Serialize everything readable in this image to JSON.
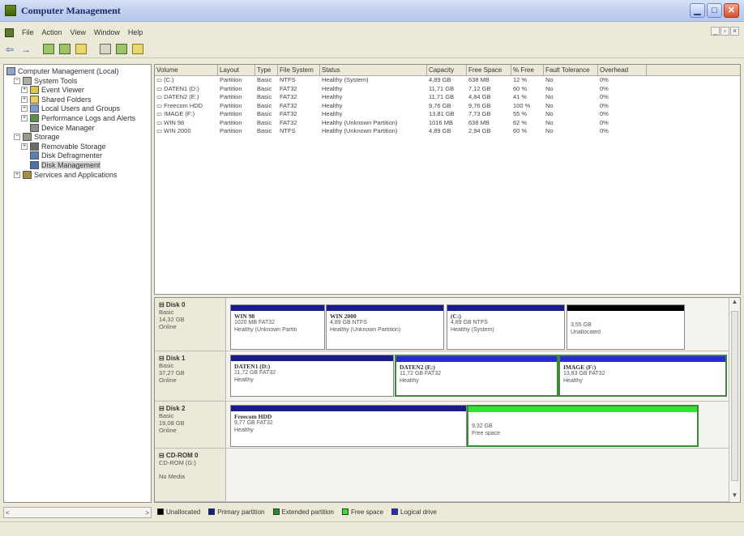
{
  "window": {
    "title": "Computer Management"
  },
  "menu": {
    "items": [
      "File",
      "Action",
      "View",
      "Window",
      "Help"
    ]
  },
  "tree": {
    "nodes": [
      {
        "label": "Computer Management (Local)",
        "indent": 0,
        "icon": "computer-icon",
        "expander": ""
      },
      {
        "label": "System Tools",
        "indent": 1,
        "icon": "tools-icon",
        "expander": "−"
      },
      {
        "label": "Event Viewer",
        "indent": 2,
        "icon": "event-viewer-icon",
        "expander": "+"
      },
      {
        "label": "Shared Folders",
        "indent": 2,
        "icon": "shared-folder-icon",
        "expander": "+"
      },
      {
        "label": "Local Users and Groups",
        "indent": 2,
        "icon": "users-icon",
        "expander": "+"
      },
      {
        "label": "Performance Logs and Alerts",
        "indent": 2,
        "icon": "performance-icon",
        "expander": "+"
      },
      {
        "label": "Device Manager",
        "indent": 2,
        "icon": "device-manager-icon",
        "expander": ""
      },
      {
        "label": "Storage",
        "indent": 1,
        "icon": "storage-icon",
        "expander": "−"
      },
      {
        "label": "Removable Storage",
        "indent": 2,
        "icon": "removable-storage-icon",
        "expander": "+"
      },
      {
        "label": "Disk Defragmenter",
        "indent": 2,
        "icon": "defragmenter-icon",
        "expander": ""
      },
      {
        "label": "Disk Management",
        "indent": 2,
        "icon": "disk-management-icon",
        "expander": "",
        "selected": true
      },
      {
        "label": "Services and Applications",
        "indent": 1,
        "icon": "services-icon",
        "expander": "+"
      }
    ]
  },
  "volumes": {
    "columns": [
      "Volume",
      "Layout",
      "Type",
      "File System",
      "Status",
      "Capacity",
      "Free Space",
      "% Free",
      "Fault Tolerance",
      "Overhead"
    ],
    "rows": [
      [
        "(C:)",
        "Partition",
        "Basic",
        "NTFS",
        "Healthy (System)",
        "4,89 GB",
        "638 MB",
        "12 %",
        "No",
        "0%"
      ],
      [
        "DATEN1 (D:)",
        "Partition",
        "Basic",
        "FAT32",
        "Healthy",
        "11,71 GB",
        "7,12 GB",
        "60 %",
        "No",
        "0%"
      ],
      [
        "DATEN2 (E:)",
        "Partition",
        "Basic",
        "FAT32",
        "Healthy",
        "11,71 GB",
        "4,84 GB",
        "41 %",
        "No",
        "0%"
      ],
      [
        "Freecom HDD",
        "Partition",
        "Basic",
        "FAT32",
        "Healthy",
        "9,76 GB",
        "9,76 GB",
        "100 %",
        "No",
        "0%"
      ],
      [
        "IMAGE (F:)",
        "Partition",
        "Basic",
        "FAT32",
        "Healthy",
        "13,81 GB",
        "7,73 GB",
        "55 %",
        "No",
        "0%"
      ],
      [
        "WIN 98",
        "Partition",
        "Basic",
        "FAT32",
        "Healthy (Unknown Partition)",
        "1016 MB",
        "638 MB",
        "62 %",
        "No",
        "0%"
      ],
      [
        "WIN 2000",
        "Partition",
        "Basic",
        "NTFS",
        "Healthy (Unknown Partition)",
        "4,89 GB",
        "2,94 GB",
        "60 %",
        "No",
        "0%"
      ]
    ]
  },
  "disks": [
    {
      "name": "Disk 0",
      "type": "Basic",
      "size": "14,32 GB",
      "status": "Online",
      "partitions": [
        {
          "name": "WIN 98",
          "line1": "1020 MB FAT32",
          "line2": "Healthy (Unknown Partiti",
          "kind": "primary"
        },
        {
          "name": "WIN 2000",
          "line1": "4,89 GB NTFS",
          "line2": "Healthy (Unknown Partition)",
          "kind": "primary"
        },
        {
          "name": "(C:)",
          "line1": "4,89 GB NTFS",
          "line2": "Healthy (System)",
          "kind": "primary"
        },
        {
          "name": "",
          "line1": "3,55 GB",
          "line2": "Unallocated",
          "kind": "unallocated"
        }
      ]
    },
    {
      "name": "Disk 1",
      "type": "Basic",
      "size": "37,27 GB",
      "status": "Online",
      "partitions": [
        {
          "name": "DATEN1 (D:)",
          "line1": "11,72 GB FAT32",
          "line2": "Healthy",
          "kind": "primary"
        },
        {
          "name": "DATEN2 (E:)",
          "line1": "11,72 GB FAT32",
          "line2": "Healthy",
          "kind": "logical"
        },
        {
          "name": "IMAGE (F:)",
          "line1": "13,83 GB FAT32",
          "line2": "Healthy",
          "kind": "logical"
        }
      ]
    },
    {
      "name": "Disk 2",
      "type": "Basic",
      "size": "19,08 GB",
      "status": "Online",
      "partitions": [
        {
          "name": "Freecom HDD",
          "line1": "9,77 GB FAT32",
          "line2": "Healthy",
          "kind": "primary"
        },
        {
          "name": "",
          "line1": "9,32 GB",
          "line2": "Free space",
          "kind": "free"
        }
      ]
    },
    {
      "name": "CD-ROM 0",
      "type": "CD-ROM (G:)",
      "size": "",
      "status": "No Media",
      "partitions": []
    }
  ],
  "legend": [
    {
      "label": "Unallocated",
      "color": "#000000"
    },
    {
      "label": "Primary partition",
      "color": "#1a1a8a"
    },
    {
      "label": "Extended partition",
      "color": "#2e8b2e"
    },
    {
      "label": "Free space",
      "color": "#35e035"
    },
    {
      "label": "Logical drive",
      "color": "#2b2bd0"
    }
  ]
}
